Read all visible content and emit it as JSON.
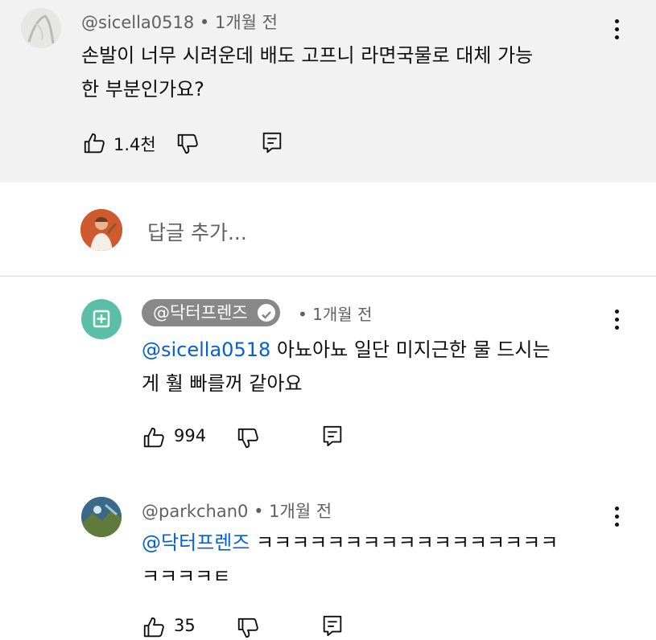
{
  "comments": [
    {
      "author": "@sicella0518",
      "time": "• 1개월 전",
      "text_line1": "손발이 너무 시려운데 배도 고프니 라면국물로 대체 가능",
      "text_line2": "한 부분인가요?",
      "likes": "1.4천"
    }
  ],
  "reply_box": {
    "placeholder": "답글 추가..."
  },
  "replies": [
    {
      "author": "@닥터프렌즈",
      "verified": true,
      "time": "• 1개월 전",
      "mention": "@sicella0518",
      "text_line1": " 아뇨아뇨 일단 미지근한 물 드시는",
      "text_line2": "게 훨 빠를꺼 같아요",
      "likes": "994"
    },
    {
      "author": "@parkchan0",
      "time": "• 1개월 전",
      "mention": "@닥터프렌즈",
      "text_line1": " ㅋㅋㅋㅋㅋㅋㅋㅋㅋㅋㅋㅋㅋㅋㅋㅋㅋ",
      "text_line2": "ㅋㅋㅋㅋㅌ",
      "likes": "35"
    }
  ],
  "colors": {
    "link": "#065fd4",
    "top_bg": "#f2f2f2",
    "channel_badge": "#5bbfa8"
  },
  "icons": [
    "thumbs-up-icon",
    "thumbs-down-icon",
    "reply-icon",
    "more-vert-icon",
    "verified-check-icon"
  ]
}
